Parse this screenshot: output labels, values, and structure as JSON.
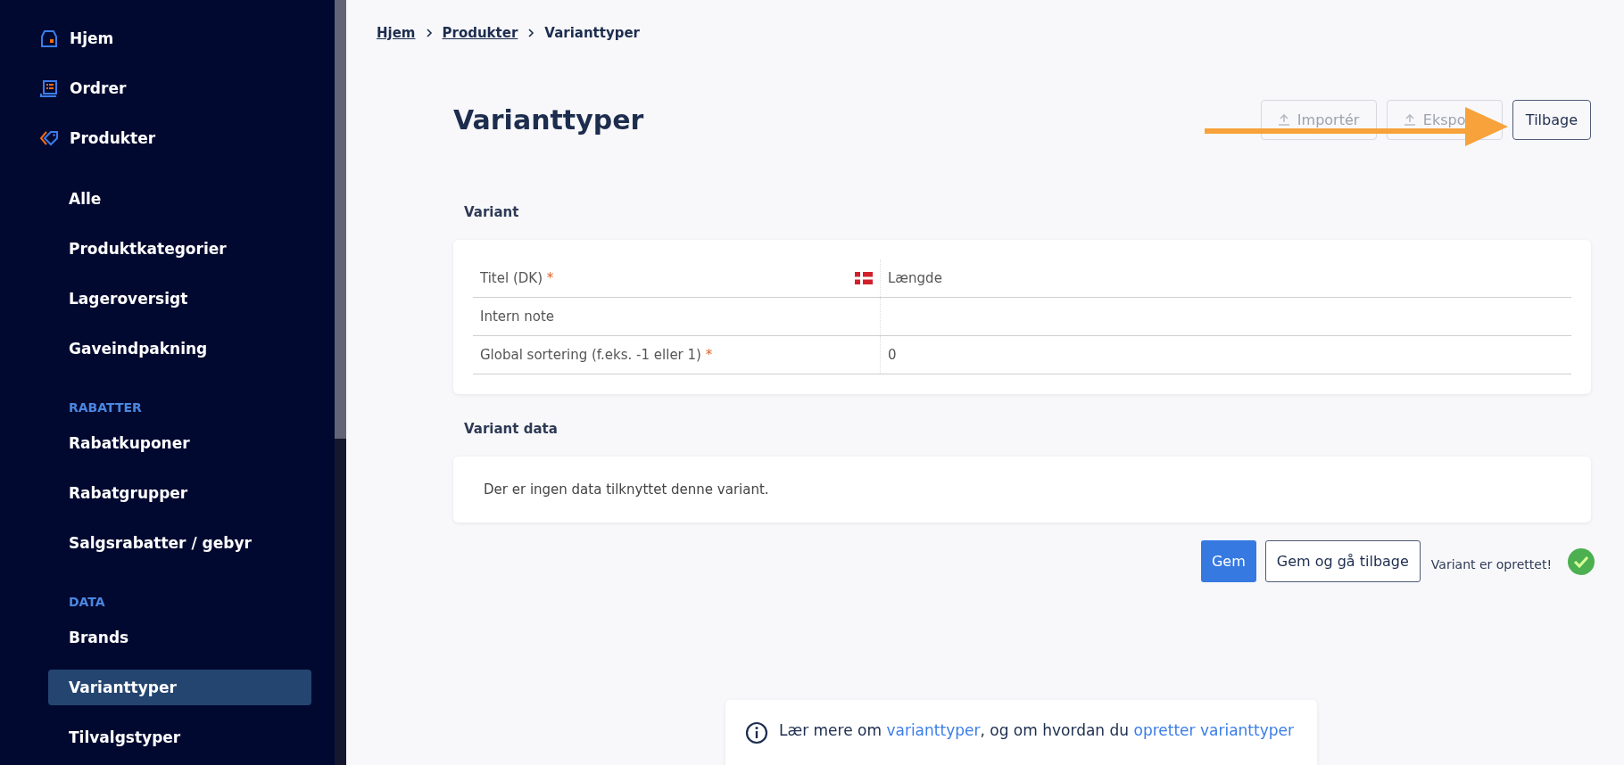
{
  "sidebar": {
    "items": [
      {
        "kind": "top",
        "label": "Hjem",
        "selected": false
      },
      {
        "kind": "top",
        "label": "Ordrer",
        "selected": false
      },
      {
        "kind": "top",
        "label": "Produkter",
        "selected": false
      },
      {
        "kind": "sub",
        "label": "Alle",
        "selected": false
      },
      {
        "kind": "sub",
        "label": "Produktkategorier",
        "selected": false
      },
      {
        "kind": "sub",
        "label": "Lageroversigt",
        "selected": false
      },
      {
        "kind": "sub",
        "label": "Gaveindpakning",
        "selected": false
      },
      {
        "kind": "heading",
        "label": "RABATTER"
      },
      {
        "kind": "sub",
        "label": "Rabatkuponer",
        "selected": false
      },
      {
        "kind": "sub",
        "label": "Rabatgrupper",
        "selected": false
      },
      {
        "kind": "sub",
        "label": "Salgsrabatter / gebyr",
        "selected": false
      },
      {
        "kind": "heading",
        "label": "DATA"
      },
      {
        "kind": "sub",
        "label": "Brands",
        "selected": false
      },
      {
        "kind": "sub",
        "label": "Varianttyper",
        "selected": true
      },
      {
        "kind": "sub",
        "label": "Tilvalgstyper",
        "selected": false
      }
    ]
  },
  "breadcrumb": [
    {
      "label": "Hjem",
      "link": true
    },
    {
      "label": "Produkter",
      "link": true
    },
    {
      "label": "Varianttyper",
      "link": false
    }
  ],
  "page_title": "Varianttyper",
  "header_buttons": [
    {
      "label": "Importér",
      "disabled": true
    },
    {
      "label": "Ekspo",
      "disabled": true
    },
    {
      "label": "Tilbage",
      "disabled": false
    }
  ],
  "variant_section": {
    "title": "Variant",
    "required_mark": "*",
    "rows": [
      {
        "label": "Titel (DK)",
        "required": true,
        "flag": true,
        "value": "Længde"
      },
      {
        "label": "Intern note",
        "required": false,
        "flag": false
      },
      {
        "label": "Global sortering (f.eks. -1 eller 1)",
        "required": true,
        "flag": false,
        "value": "0"
      }
    ]
  },
  "variant_data_section": {
    "title": "Variant data",
    "empty_text": "Der er ingen data tilknyttet denne variant."
  },
  "actions": {
    "save": "Gem",
    "save_back": "Gem og gå tilbage",
    "status": "Variant er oprettet!"
  },
  "info": {
    "parts": [
      {
        "text": "Lær mere om ",
        "link": false
      },
      {
        "text": "varianttyper",
        "link": true
      },
      {
        "text": ", og om hvordan du ",
        "link": false
      },
      {
        "text": "opretter varianttyper",
        "link": true
      }
    ]
  }
}
